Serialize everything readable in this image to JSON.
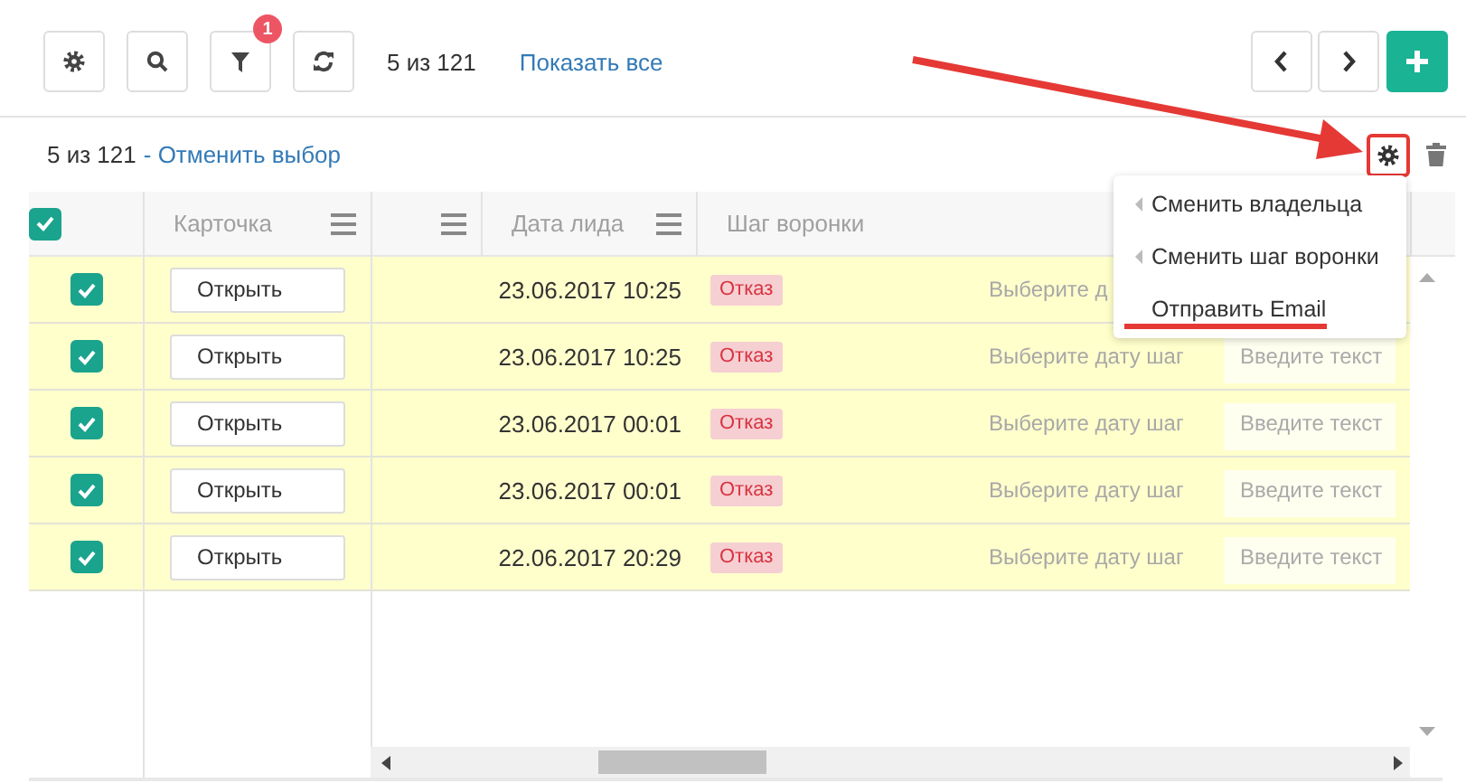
{
  "toolbar": {
    "filter_badge": "1",
    "count": "5 из 121",
    "show_all_link": "Показать все"
  },
  "selection": {
    "count": "5 из 121",
    "cancel_link": "- Отменить выбор",
    "settings_highlighted": true
  },
  "annotation_arrow": true,
  "table": {
    "columns": [
      {
        "kind": "check",
        "checked": true
      },
      {
        "kind": "label",
        "label": "Карточка",
        "menu": true
      },
      {
        "kind": "blank",
        "menu": true
      },
      {
        "kind": "label",
        "label": "Дата лида",
        "menu": true
      },
      {
        "kind": "label",
        "label": "Шаг воронки"
      }
    ],
    "rows": [
      {
        "checked": true,
        "open": "Открыть",
        "date": "23.06.2017 10:25",
        "status": "Отказ",
        "step_date": "Выберите д"
      },
      {
        "checked": true,
        "open": "Открыть",
        "date": "23.06.2017 10:25",
        "status": "Отказ",
        "step_date": "Выберите дату шаг",
        "note": "Введите текст"
      },
      {
        "checked": true,
        "open": "Открыть",
        "date": "23.06.2017 00:01",
        "status": "Отказ",
        "step_date": "Выберите дату шаг",
        "note": "Введите текст"
      },
      {
        "checked": true,
        "open": "Открыть",
        "date": "23.06.2017 00:01",
        "status": "Отказ",
        "step_date": "Выберите дату шаг",
        "note": "Введите текст"
      },
      {
        "checked": true,
        "open": "Открыть",
        "date": "22.06.2017 20:29",
        "status": "Отказ",
        "step_date": "Выберите дату шаг",
        "note": "Введите текст"
      }
    ]
  },
  "menu": {
    "items": [
      {
        "label": "Сменить владельца",
        "submenu": true,
        "underlined": false
      },
      {
        "label": "Сменить шаг воронки",
        "submenu": true,
        "underlined": false
      },
      {
        "label": "Отправить Email",
        "submenu": false,
        "underlined": true
      }
    ]
  }
}
